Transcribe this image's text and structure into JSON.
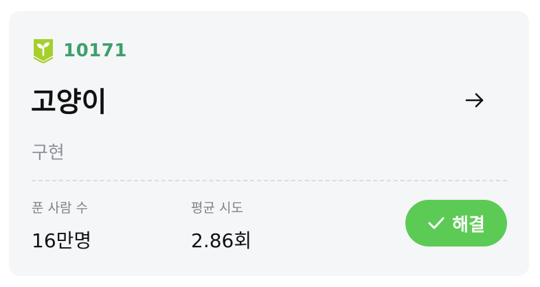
{
  "problem": {
    "id": "10171",
    "title": "고양이",
    "tag": "구현",
    "tier_icon": "sprout-shield-icon",
    "tier_color": "#a6cf2c"
  },
  "stats": {
    "solvers_label": "푼 사람 수",
    "solvers_value": "16만명",
    "attempts_label": "평균 시도",
    "attempts_value": "2.86회"
  },
  "status_button": {
    "label": "해결",
    "icon": "check-icon",
    "color": "#5ccb55"
  },
  "navigation": {
    "icon": "arrow-right-icon"
  },
  "colors": {
    "card_background": "#f5f6f8",
    "id_text": "#3ba06a",
    "muted_text": "#8b8f96"
  }
}
